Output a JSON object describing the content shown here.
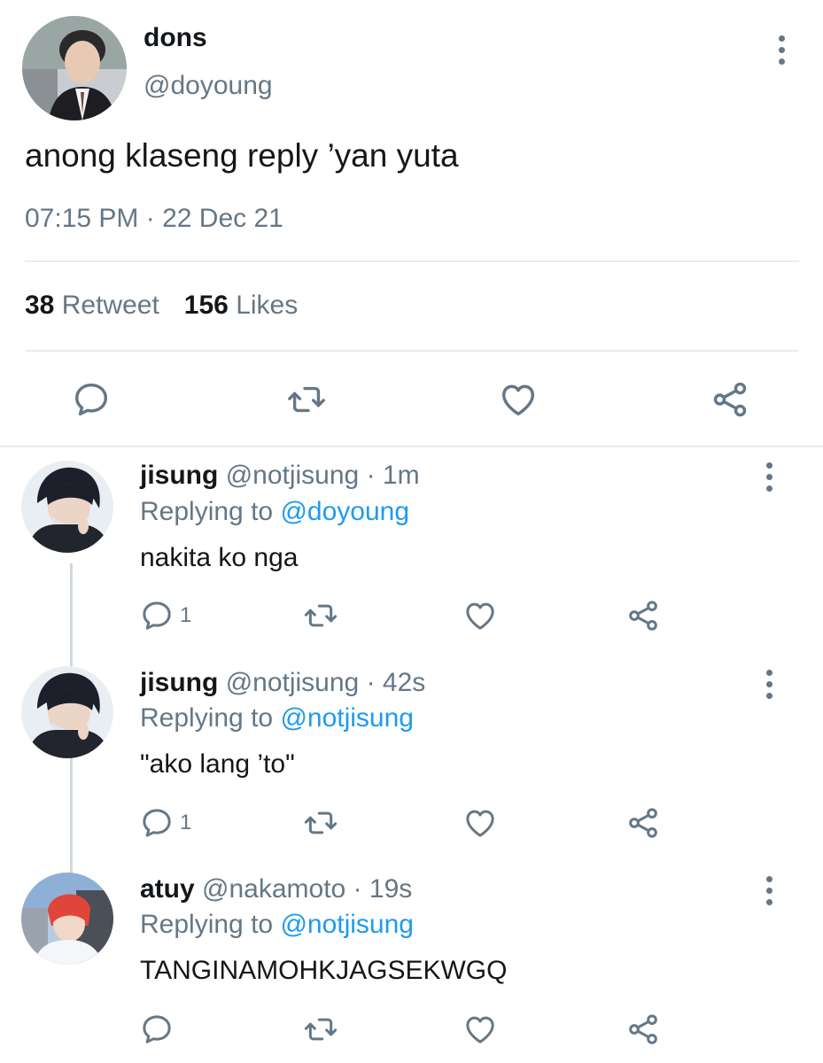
{
  "tweet": {
    "name": "dons",
    "handle": "@doyoung",
    "text": "anong klaseng reply ’yan yuta",
    "timestamp": "07:15 PM · 22 Dec 21",
    "retweets_count": "38",
    "retweets_label": "Retweet",
    "likes_count": "156",
    "likes_label": "Likes"
  },
  "replies": [
    {
      "name": "jisung",
      "handle": "@notjisung",
      "time": "· 1m",
      "replying_prefix": "Replying to",
      "replying_to": "@doyoung",
      "text": "nakita ko nga",
      "reply_count": "1"
    },
    {
      "name": "jisung",
      "handle": "@notjisung",
      "time": "· 42s",
      "replying_prefix": "Replying to",
      "replying_to": "@notjisung",
      "text": "\"ako lang ’to\"",
      "reply_count": "1"
    },
    {
      "name": "atuy",
      "handle": "@nakamoto",
      "time": "· 19s",
      "replying_prefix": "Replying to",
      "replying_to": "@notjisung",
      "text": "TANGINAMOHKJAGSEKWGQ",
      "reply_count": ""
    }
  ],
  "icons": {
    "reply": "reply-icon",
    "retweet": "retweet-icon",
    "like": "heart-icon",
    "share": "share-icon",
    "more": "more-vertical-icon"
  },
  "colors": {
    "text": "#14171a",
    "muted": "#657786",
    "mention": "#1d9bf0",
    "divider": "#e6ecf0"
  }
}
